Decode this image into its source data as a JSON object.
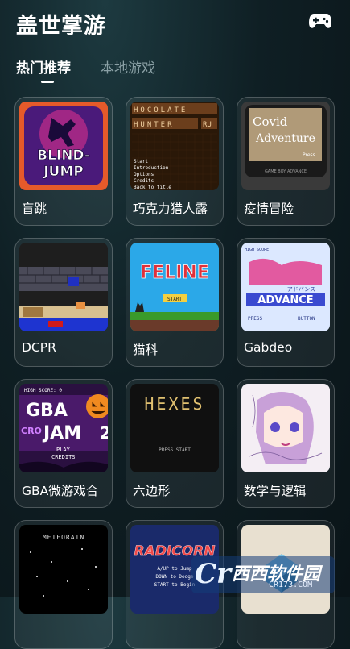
{
  "header": {
    "title": "盖世掌游"
  },
  "tabs": [
    {
      "label": "热门推荐",
      "active": true
    },
    {
      "label": "本地游戏",
      "active": false
    }
  ],
  "games": [
    {
      "label": "盲跳",
      "thumb_text": [
        "BLIND-",
        "JUMP"
      ]
    },
    {
      "label": "巧克力猎人露",
      "thumb_text": [
        "HOCOLATE",
        "HUNTER",
        "RU",
        "Start",
        "Introduction",
        "Options",
        "Credits",
        "Back to title"
      ]
    },
    {
      "label": "疫情冒险",
      "thumb_text": [
        "Covid",
        "Adventure",
        "Press",
        "GAME BOY ADVANCE"
      ]
    },
    {
      "label": "DCPR",
      "thumb_text": []
    },
    {
      "label": "猫科",
      "thumb_text": [
        "FELINE",
        "START"
      ]
    },
    {
      "label": "Gabdeo",
      "thumb_text": [
        "HIGH SCORE",
        "ADVANCE",
        "アドバンス",
        "PRESS",
        "BUTTON"
      ]
    },
    {
      "label": "GBA微游戏合",
      "thumb_text": [
        "HIGH SCORE: 0",
        "GBA",
        "CRO",
        "JAM",
        "2",
        "PLAY",
        "CREDITS"
      ]
    },
    {
      "label": "六边形",
      "thumb_text": [
        "HEXES",
        "PRESS START"
      ]
    },
    {
      "label": "数学与逻辑",
      "thumb_text": []
    },
    {
      "label": "",
      "thumb_text": [
        "METEORAIN"
      ]
    },
    {
      "label": "",
      "thumb_text": [
        "RADICORN",
        "A/UP to Jump",
        "DOWN to Dodge",
        "START to Begin"
      ]
    },
    {
      "label": "",
      "thumb_text": []
    }
  ],
  "watermark": {
    "logo": "Cr",
    "name": "西西软件园",
    "url": "CR173.COM"
  },
  "colors": {
    "background": "#0f1f24",
    "tab_inactive": "#8aa0a5",
    "card_border": "rgba(255,255,255,0.22)"
  },
  "icons": {
    "header_action": "gamepad-icon"
  }
}
